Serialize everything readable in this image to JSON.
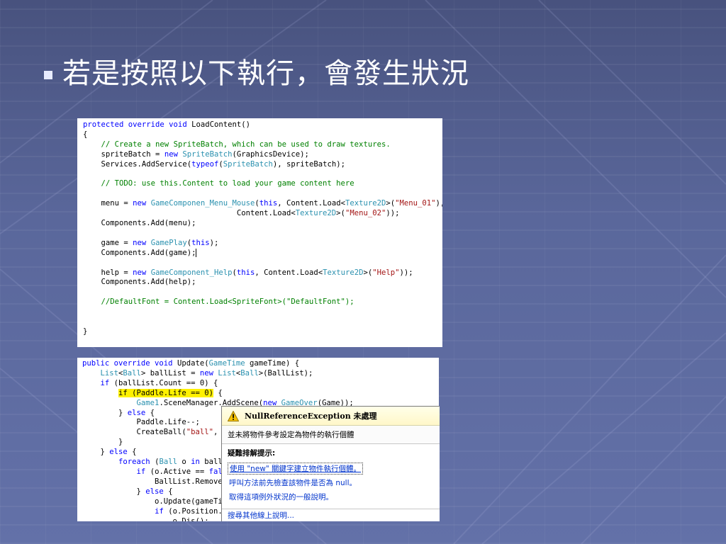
{
  "slide": {
    "title": "若是按照以下執行，會發生狀況"
  },
  "code_load_content": {
    "lines": [
      [
        {
          "t": "protected override void ",
          "c": "kw"
        },
        {
          "t": "LoadContent()"
        }
      ],
      [
        {
          "t": "{"
        }
      ],
      [
        {
          "t": "    "
        },
        {
          "t": "// Create a new SpriteBatch, which can be used to draw textures.",
          "c": "cm"
        }
      ],
      [
        {
          "t": "    spriteBatch = "
        },
        {
          "t": "new ",
          "c": "kw"
        },
        {
          "t": "SpriteBatch",
          "c": "ty"
        },
        {
          "t": "(GraphicsDevice);"
        }
      ],
      [
        {
          "t": "    Services.AddService("
        },
        {
          "t": "typeof",
          "c": "kw"
        },
        {
          "t": "("
        },
        {
          "t": "SpriteBatch",
          "c": "ty"
        },
        {
          "t": "), spriteBatch);"
        }
      ],
      [
        {
          "t": ""
        }
      ],
      [
        {
          "t": "    "
        },
        {
          "t": "// TODO: use this.Content to load your game content here",
          "c": "cm"
        }
      ],
      [
        {
          "t": ""
        }
      ],
      [
        {
          "t": "    menu = "
        },
        {
          "t": "new ",
          "c": "kw"
        },
        {
          "t": "GameComponen_Menu_Mouse",
          "c": "ty"
        },
        {
          "t": "("
        },
        {
          "t": "this",
          "c": "kw"
        },
        {
          "t": ", Content.Load<"
        },
        {
          "t": "Texture2D",
          "c": "ty"
        },
        {
          "t": ">("
        },
        {
          "t": "\"Menu_01\"",
          "c": "st"
        },
        {
          "t": "),"
        }
      ],
      [
        {
          "t": "                                  Content.Load<"
        },
        {
          "t": "Texture2D",
          "c": "ty"
        },
        {
          "t": ">("
        },
        {
          "t": "\"Menu_02\"",
          "c": "st"
        },
        {
          "t": "));"
        }
      ],
      [
        {
          "t": "    Components.Add(menu);"
        }
      ],
      [
        {
          "t": ""
        }
      ],
      [
        {
          "t": "    game = "
        },
        {
          "t": "new ",
          "c": "kw"
        },
        {
          "t": "GamePlay",
          "c": "ty"
        },
        {
          "t": "("
        },
        {
          "t": "this",
          "c": "kw"
        },
        {
          "t": ");"
        }
      ],
      [
        {
          "t": "    Components.Add(game);"
        },
        {
          "t": "",
          "c": "caret"
        }
      ],
      [
        {
          "t": ""
        }
      ],
      [
        {
          "t": "    help = "
        },
        {
          "t": "new ",
          "c": "kw"
        },
        {
          "t": "GameComponent_Help",
          "c": "ty"
        },
        {
          "t": "("
        },
        {
          "t": "this",
          "c": "kw"
        },
        {
          "t": ", Content.Load<"
        },
        {
          "t": "Texture2D",
          "c": "ty"
        },
        {
          "t": ">("
        },
        {
          "t": "\"Help\"",
          "c": "st"
        },
        {
          "t": "));"
        }
      ],
      [
        {
          "t": "    Components.Add(help);"
        }
      ],
      [
        {
          "t": ""
        }
      ],
      [
        {
          "t": "    "
        },
        {
          "t": "//DefaultFont = Content.Load<SpriteFont>(\"DefaultFont\");",
          "c": "cm"
        }
      ],
      [
        {
          "t": ""
        }
      ],
      [
        {
          "t": ""
        }
      ],
      [
        {
          "t": "}"
        }
      ]
    ]
  },
  "code_update": {
    "lines": [
      [
        {
          "t": "public override void ",
          "c": "kw"
        },
        {
          "t": "Update("
        },
        {
          "t": "GameTime",
          "c": "ty"
        },
        {
          "t": " gameTime) {"
        }
      ],
      [
        {
          "t": "    "
        },
        {
          "t": "List",
          "c": "ty"
        },
        {
          "t": "<"
        },
        {
          "t": "Ball",
          "c": "ty"
        },
        {
          "t": "> ballList = "
        },
        {
          "t": "new ",
          "c": "kw"
        },
        {
          "t": "List",
          "c": "ty"
        },
        {
          "t": "<"
        },
        {
          "t": "Ball",
          "c": "ty"
        },
        {
          "t": ">(BallList);"
        }
      ],
      [
        {
          "t": "    "
        },
        {
          "t": "if ",
          "c": "kw"
        },
        {
          "t": "(ballList.Count == 0) {"
        }
      ],
      [
        {
          "t": "        "
        },
        {
          "t": "if (Paddle.Life == 0)",
          "c": "hl"
        },
        {
          "t": " {"
        }
      ],
      [
        {
          "t": "            "
        },
        {
          "t": "Game1",
          "c": "ty"
        },
        {
          "t": ".SceneManager.AddScene("
        },
        {
          "t": "new ",
          "c": "kw"
        },
        {
          "t": "GameOver",
          "c": "ty"
        },
        {
          "t": "(Game));"
        }
      ],
      [
        {
          "t": "        } "
        },
        {
          "t": "else ",
          "c": "kw"
        },
        {
          "t": "{"
        }
      ],
      [
        {
          "t": "            Paddle.Life--;"
        }
      ],
      [
        {
          "t": "            CreateBall("
        },
        {
          "t": "\"ball\"",
          "c": "st"
        },
        {
          "t": ","
        }
      ],
      [
        {
          "t": "        }"
        }
      ],
      [
        {
          "t": "    } "
        },
        {
          "t": "else ",
          "c": "kw"
        },
        {
          "t": "{"
        }
      ],
      [
        {
          "t": "        "
        },
        {
          "t": "foreach ",
          "c": "kw"
        },
        {
          "t": "("
        },
        {
          "t": "Ball",
          "c": "ty"
        },
        {
          "t": " o "
        },
        {
          "t": "in ",
          "c": "kw"
        },
        {
          "t": "ball"
        }
      ],
      [
        {
          "t": "            "
        },
        {
          "t": "if ",
          "c": "kw"
        },
        {
          "t": "(o.Active == "
        },
        {
          "t": "fal",
          "c": "kw"
        }
      ],
      [
        {
          "t": "                BallList.Remove"
        }
      ],
      [
        {
          "t": "            } "
        },
        {
          "t": "else ",
          "c": "kw"
        },
        {
          "t": "{"
        }
      ],
      [
        {
          "t": "                o.Update(gameTi"
        }
      ],
      [
        {
          "t": "                "
        },
        {
          "t": "if ",
          "c": "kw"
        },
        {
          "t": "(o.Position."
        }
      ],
      [
        {
          "t": "                    o.Dis();"
        }
      ]
    ]
  },
  "exception_dialog": {
    "title": "NullReferenceException 未處理",
    "message": "並未將物件參考設定為物件的執行個體",
    "section_label": "疑難排解提示:",
    "tips": [
      "使用 \"new\" 關鍵字建立物件執行個體。",
      "呼叫方法前先檢查該物件是否為 null。",
      "取得這項例外狀況的一般說明。"
    ],
    "footer_link": "搜尋其他線上說明..."
  }
}
